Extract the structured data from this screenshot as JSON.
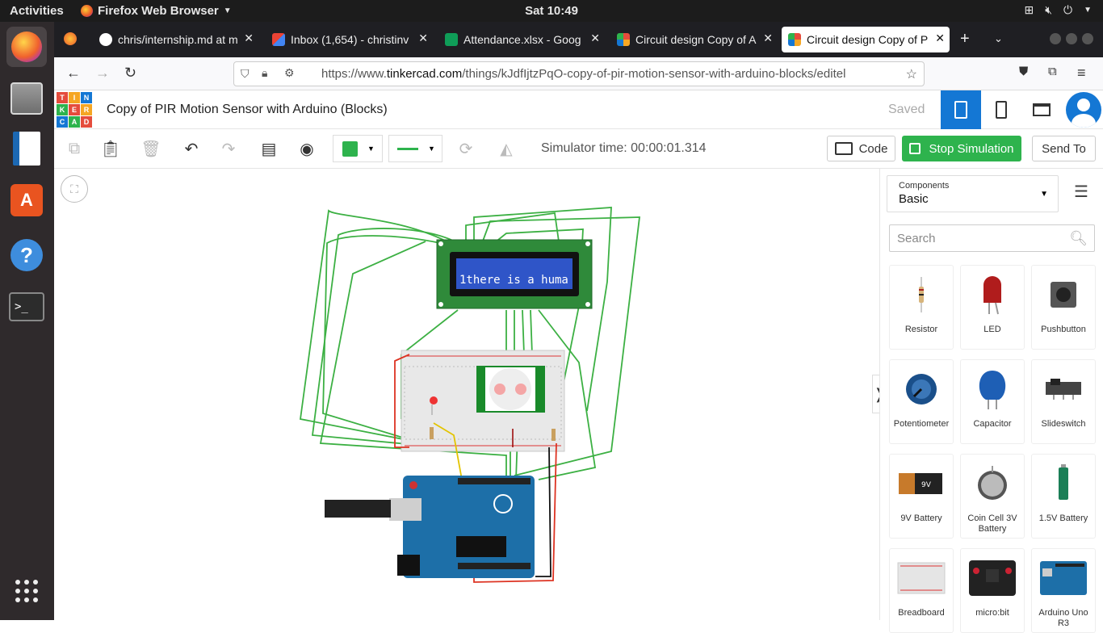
{
  "topbar": {
    "activities": "Activities",
    "app_name": "Firefox Web Browser",
    "clock": "Sat 10:49"
  },
  "browser": {
    "tabs": [
      {
        "label": "chris/internship.md at m",
        "icon": "github-icon"
      },
      {
        "label": "Inbox (1,654) - christinv",
        "icon": "gmail-icon"
      },
      {
        "label": "Attendance.xlsx - Goog",
        "icon": "sheets-icon"
      },
      {
        "label": "Circuit design Copy of A",
        "icon": "tinkercad-icon"
      },
      {
        "label": "Circuit design Copy of P",
        "icon": "tinkercad-icon"
      }
    ],
    "url_prefix": "https://www.",
    "url_host": "tinkercad.com",
    "url_path": "/things/kJdfIjtzPqO-copy-of-pir-motion-sensor-with-arduino-blocks/editel"
  },
  "tinkercad": {
    "logo": [
      "TIN",
      "KER",
      "CAD"
    ],
    "project_title": "Copy of PIR Motion Sensor with Arduino (Blocks)",
    "save_status": "Saved",
    "simulator_time": "Simulator time: 00:00:01.314",
    "code_label": "Code",
    "stop_label": "Stop Simulation",
    "send_label": "Send To",
    "lcd_text": "1there is a huma"
  },
  "components_panel": {
    "selector_label": "Components",
    "selector_value": "Basic",
    "search_placeholder": "Search",
    "items": [
      {
        "name": "Resistor"
      },
      {
        "name": "LED"
      },
      {
        "name": "Pushbutton"
      },
      {
        "name": "Potentiometer"
      },
      {
        "name": "Capacitor"
      },
      {
        "name": "Slideswitch"
      },
      {
        "name": "9V Battery"
      },
      {
        "name": "Coin Cell 3V Battery"
      },
      {
        "name": "1.5V Battery"
      },
      {
        "name": "Breadboard"
      },
      {
        "name": "micro:bit"
      },
      {
        "name": "Arduino Uno R3"
      }
    ]
  },
  "colors": {
    "tinkercad_blue": "#1477d4",
    "stop_green": "#2eb34d",
    "wire_green": "#3cb043",
    "lcd_blue": "#2f55c8"
  }
}
